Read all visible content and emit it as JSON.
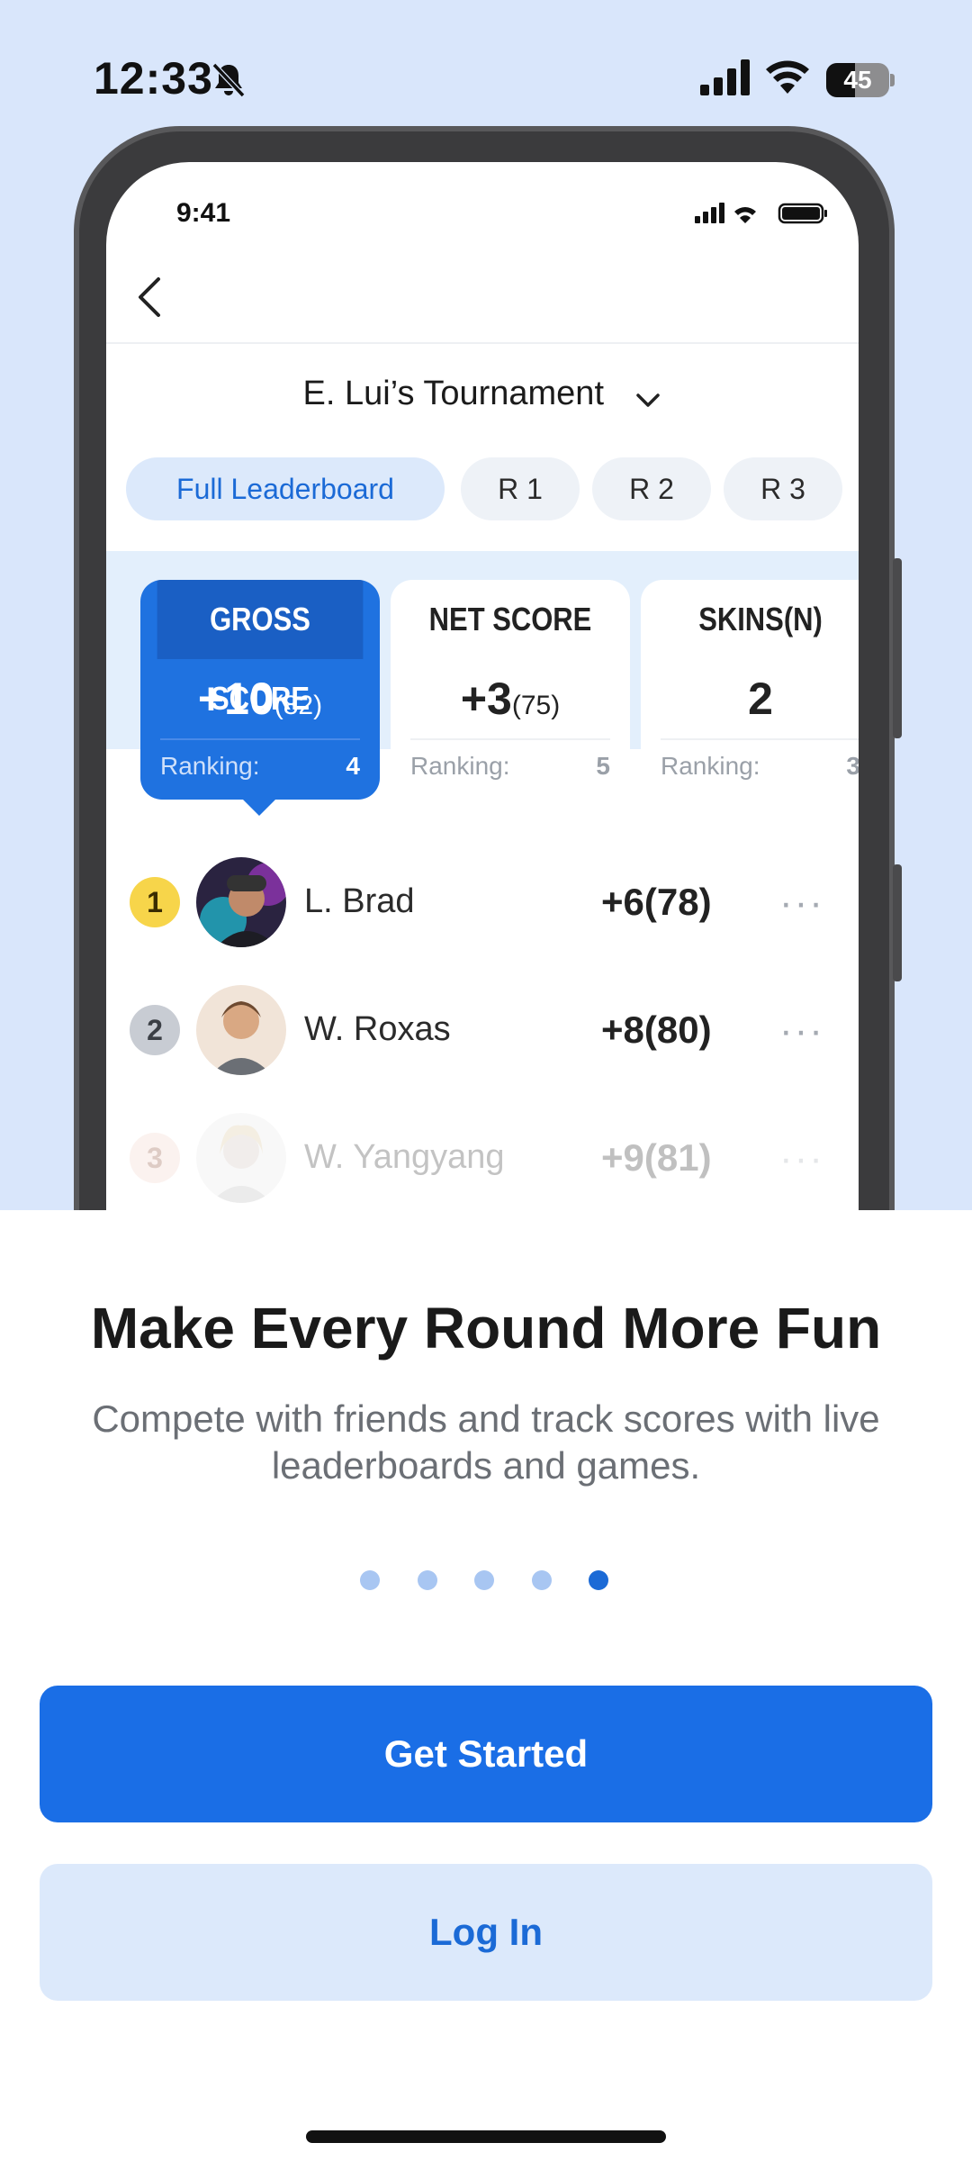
{
  "status_bar": {
    "time": "12:33",
    "battery_level": "45",
    "battery_fraction": 0.45
  },
  "mockup": {
    "status_time": "9:41",
    "tournament_title": "E. Lui’s Tournament",
    "tabs": [
      "Full Leaderboard",
      "R 1",
      "R 2",
      "R 3"
    ],
    "active_tab": 0,
    "cards": [
      {
        "title": "GROSS SCORE",
        "value": "+10",
        "value_detail": "(82)",
        "ranking_label": "Ranking:",
        "ranking": "4",
        "active": true
      },
      {
        "title": "NET SCORE",
        "value": "+3",
        "value_detail": "(75)",
        "ranking_label": "Ranking:",
        "ranking": "5",
        "active": false
      },
      {
        "title": "SKINS(N)",
        "value": "2",
        "value_detail": "",
        "ranking_label": "Ranking:",
        "ranking": "3",
        "active": false
      }
    ],
    "players": [
      {
        "rank": "1",
        "name": "L. Brad",
        "score": "+6(78)",
        "more": "···"
      },
      {
        "rank": "2",
        "name": "W. Roxas",
        "score": "+8(80)",
        "more": "···"
      },
      {
        "rank": "3",
        "name": "W. Yangyang",
        "score": "+9(81)",
        "more": "···"
      }
    ]
  },
  "onboarding": {
    "headline": "Make Every Round More Fun",
    "subtext": "Compete with friends and track scores with live leaderboards and games.",
    "page_count": 5,
    "current_page": 5,
    "primary_button": "Get Started",
    "secondary_button": "Log In"
  },
  "colors": {
    "accent": "#1a6ee6",
    "hero_bg": "#d9e6fb",
    "secondary_button_bg": "#dce9fb",
    "gold": "#f7d54a",
    "silver": "#c8ccd3",
    "bronze": "#f2d3c8"
  }
}
